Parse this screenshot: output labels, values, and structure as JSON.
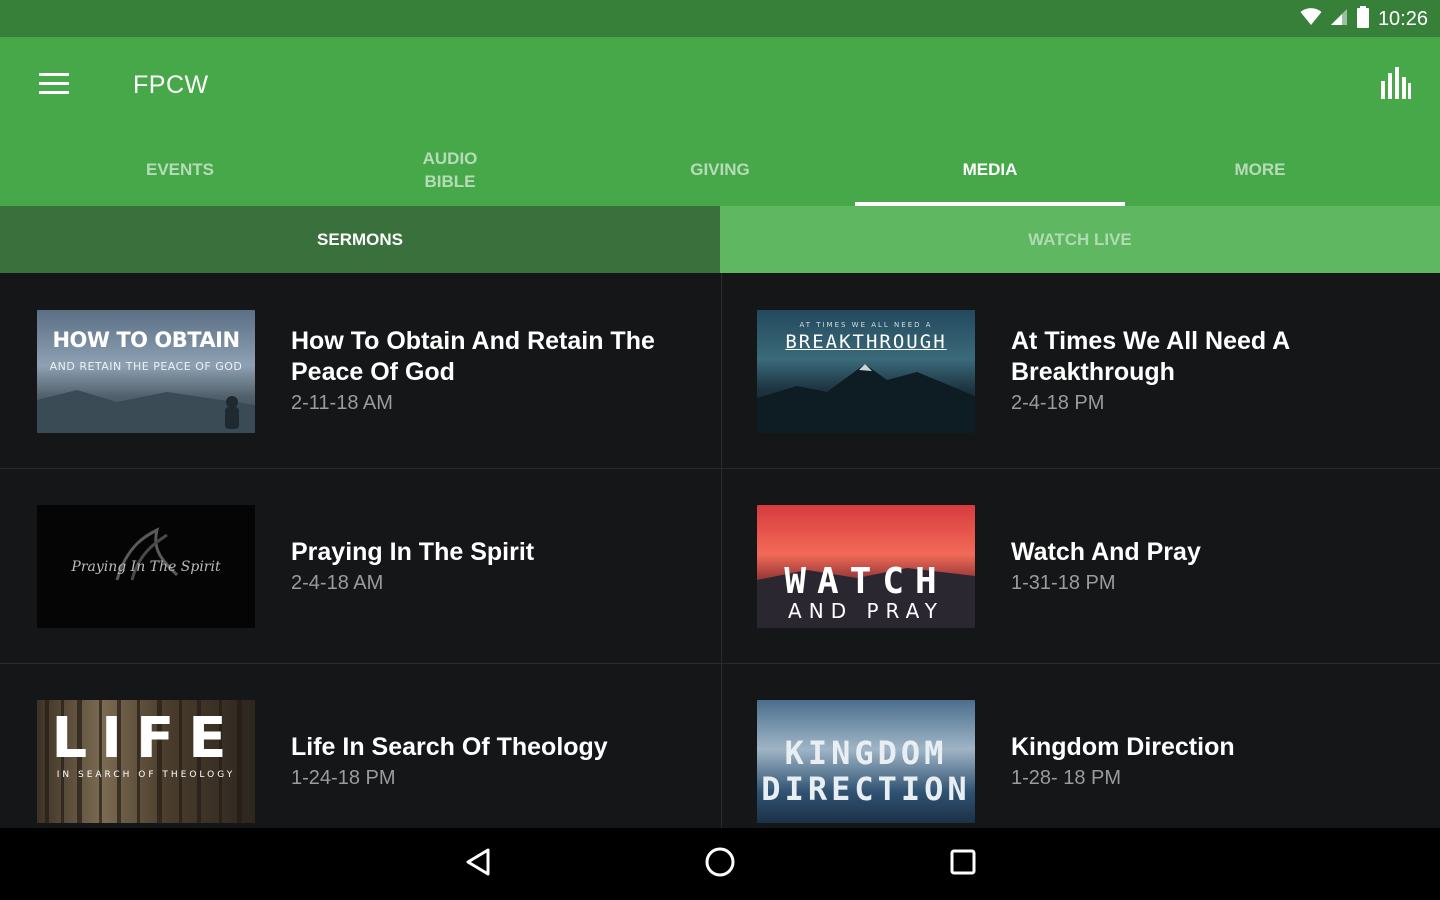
{
  "status": {
    "time": "10:26"
  },
  "app": {
    "title": "FPCW"
  },
  "tabs": [
    {
      "label": "EVENTS"
    },
    {
      "label": "AUDIO BIBLE"
    },
    {
      "label": "GIVING"
    },
    {
      "label": "MEDIA"
    },
    {
      "label": "MORE"
    }
  ],
  "active_tab": "MEDIA",
  "subtabs": [
    {
      "label": "SERMONS"
    },
    {
      "label": "WATCH LIVE"
    }
  ],
  "sermons": [
    {
      "title": "How To Obtain And Retain The Peace Of God",
      "date": "2-11-18 AM",
      "thumb": {
        "line1": "HOW TO OBTAIN",
        "line2": "AND RETAIN THE PEACE OF GOD"
      }
    },
    {
      "title": "At Times We All Need A Breakthrough",
      "date": "2-4-18 PM",
      "thumb": {
        "line1": "AT TIMES WE ALL NEED A",
        "line2": "BREAKTHROUGH"
      }
    },
    {
      "title": "Praying In The Spirit",
      "date": "2-4-18 AM",
      "thumb": {
        "line1": "Praying In The Spirit"
      }
    },
    {
      "title": "Watch And Pray",
      "date": "1-31-18 PM",
      "thumb": {
        "line1": "WATCH",
        "line2": "AND PRAY"
      }
    },
    {
      "title": "Life In Search Of Theology",
      "date": "1-24-18 PM",
      "thumb": {
        "line1": "LIFE",
        "line2": "IN SEARCH OF THEOLOGY"
      }
    },
    {
      "title": "Kingdom Direction",
      "date": "1-28- 18 PM",
      "thumb": {
        "line1": "KINGDOM",
        "line2": "DIRECTION"
      }
    }
  ],
  "colors": {
    "status_bar": "#37803a",
    "primary": "#47a84a",
    "subtab_active": "#39703c",
    "subtab_inactive": "#5fb762",
    "background": "#151618"
  },
  "icons": {
    "menu": "hamburger-icon",
    "stats": "bar-chart-icon",
    "wifi": "wifi-icon",
    "signal": "signal-icon",
    "battery": "battery-icon",
    "back": "back-icon",
    "home": "home-icon",
    "recents": "recents-icon"
  }
}
